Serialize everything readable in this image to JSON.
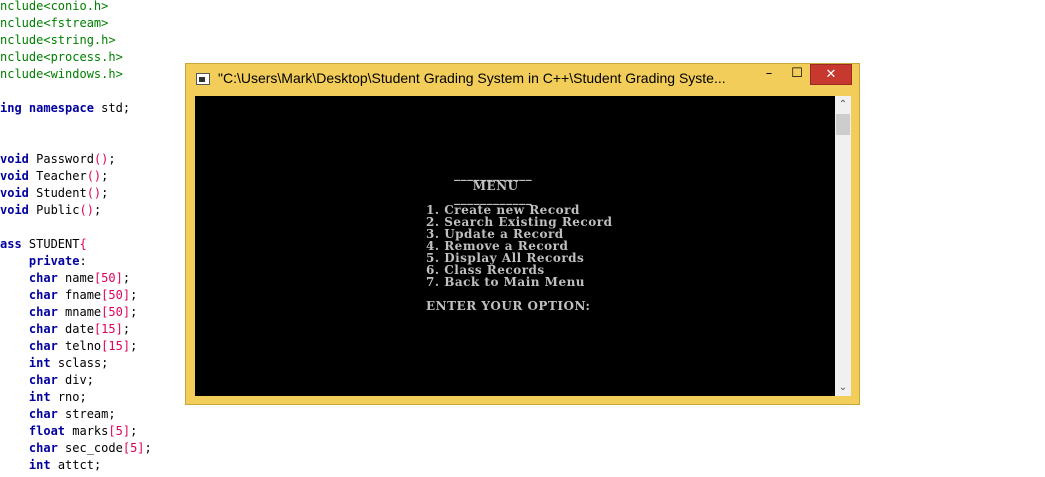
{
  "editor": {
    "lines": [
      {
        "parts": [
          {
            "t": "nclude<conio.h>",
            "c": "kw-green"
          }
        ]
      },
      {
        "parts": [
          {
            "t": "nclude<fstream>",
            "c": "kw-green"
          }
        ]
      },
      {
        "parts": [
          {
            "t": "nclude<string.h>",
            "c": "kw-green"
          }
        ]
      },
      {
        "parts": [
          {
            "t": "nclude<process.h>",
            "c": "kw-green"
          }
        ]
      },
      {
        "parts": [
          {
            "t": "nclude<windows.h>",
            "c": "kw-green"
          }
        ]
      },
      {
        "parts": [
          {
            "t": "",
            "c": "kw-plain"
          }
        ]
      },
      {
        "parts": [
          {
            "t": "ing namespace",
            "c": "kw-blue"
          },
          {
            "t": " std;",
            "c": "kw-plain"
          }
        ]
      },
      {
        "parts": [
          {
            "t": "",
            "c": "kw-plain"
          }
        ]
      },
      {
        "parts": [
          {
            "t": "",
            "c": "kw-plain"
          }
        ]
      },
      {
        "parts": [
          {
            "t": "void",
            "c": "kw-blue"
          },
          {
            "t": " Password",
            "c": "kw-plain"
          },
          {
            "t": "()",
            "c": "kw-red"
          },
          {
            "t": ";",
            "c": "kw-plain"
          }
        ]
      },
      {
        "parts": [
          {
            "t": "void",
            "c": "kw-blue"
          },
          {
            "t": " Teacher",
            "c": "kw-plain"
          },
          {
            "t": "()",
            "c": "kw-red"
          },
          {
            "t": ";",
            "c": "kw-plain"
          }
        ]
      },
      {
        "parts": [
          {
            "t": "void",
            "c": "kw-blue"
          },
          {
            "t": " Student",
            "c": "kw-plain"
          },
          {
            "t": "()",
            "c": "kw-red"
          },
          {
            "t": ";",
            "c": "kw-plain"
          }
        ]
      },
      {
        "parts": [
          {
            "t": "void",
            "c": "kw-blue"
          },
          {
            "t": " Public",
            "c": "kw-plain"
          },
          {
            "t": "()",
            "c": "kw-red"
          },
          {
            "t": ";",
            "c": "kw-plain"
          }
        ]
      },
      {
        "parts": [
          {
            "t": "",
            "c": "kw-plain"
          }
        ]
      },
      {
        "parts": [
          {
            "t": "ass",
            "c": "kw-blue"
          },
          {
            "t": " STUDENT",
            "c": "kw-plain"
          },
          {
            "t": "{",
            "c": "kw-red"
          }
        ]
      },
      {
        "parts": [
          {
            "t": "    ",
            "c": "kw-plain"
          },
          {
            "t": "private",
            "c": "kw-blue"
          },
          {
            "t": ":",
            "c": "kw-plain"
          }
        ]
      },
      {
        "parts": [
          {
            "t": "    ",
            "c": "kw-plain"
          },
          {
            "t": "char",
            "c": "kw-blue"
          },
          {
            "t": " name",
            "c": "kw-plain"
          },
          {
            "t": "[50]",
            "c": "kw-red"
          },
          {
            "t": ";",
            "c": "kw-plain"
          }
        ]
      },
      {
        "parts": [
          {
            "t": "    ",
            "c": "kw-plain"
          },
          {
            "t": "char",
            "c": "kw-blue"
          },
          {
            "t": " fname",
            "c": "kw-plain"
          },
          {
            "t": "[50]",
            "c": "kw-red"
          },
          {
            "t": ";",
            "c": "kw-plain"
          }
        ]
      },
      {
        "parts": [
          {
            "t": "    ",
            "c": "kw-plain"
          },
          {
            "t": "char",
            "c": "kw-blue"
          },
          {
            "t": " mname",
            "c": "kw-plain"
          },
          {
            "t": "[50]",
            "c": "kw-red"
          },
          {
            "t": ";",
            "c": "kw-plain"
          }
        ]
      },
      {
        "parts": [
          {
            "t": "    ",
            "c": "kw-plain"
          },
          {
            "t": "char",
            "c": "kw-blue"
          },
          {
            "t": " date",
            "c": "kw-plain"
          },
          {
            "t": "[15]",
            "c": "kw-red"
          },
          {
            "t": ";",
            "c": "kw-plain"
          }
        ]
      },
      {
        "parts": [
          {
            "t": "    ",
            "c": "kw-plain"
          },
          {
            "t": "char",
            "c": "kw-blue"
          },
          {
            "t": " telno",
            "c": "kw-plain"
          },
          {
            "t": "[15]",
            "c": "kw-red"
          },
          {
            "t": ";",
            "c": "kw-plain"
          }
        ]
      },
      {
        "parts": [
          {
            "t": "    ",
            "c": "kw-plain"
          },
          {
            "t": "int",
            "c": "kw-blue"
          },
          {
            "t": " sclass;",
            "c": "kw-plain"
          }
        ]
      },
      {
        "parts": [
          {
            "t": "    ",
            "c": "kw-plain"
          },
          {
            "t": "char",
            "c": "kw-blue"
          },
          {
            "t": " div;",
            "c": "kw-plain"
          }
        ]
      },
      {
        "parts": [
          {
            "t": "    ",
            "c": "kw-plain"
          },
          {
            "t": "int",
            "c": "kw-blue"
          },
          {
            "t": " rno;",
            "c": "kw-plain"
          }
        ]
      },
      {
        "parts": [
          {
            "t": "    ",
            "c": "kw-plain"
          },
          {
            "t": "char",
            "c": "kw-blue"
          },
          {
            "t": " stream;",
            "c": "kw-plain"
          }
        ]
      },
      {
        "parts": [
          {
            "t": "    ",
            "c": "kw-plain"
          },
          {
            "t": "float",
            "c": "kw-blue"
          },
          {
            "t": " marks",
            "c": "kw-plain"
          },
          {
            "t": "[5]",
            "c": "kw-red"
          },
          {
            "t": ";",
            "c": "kw-plain"
          }
        ]
      },
      {
        "parts": [
          {
            "t": "    ",
            "c": "kw-plain"
          },
          {
            "t": "char",
            "c": "kw-blue"
          },
          {
            "t": " sec_code",
            "c": "kw-plain"
          },
          {
            "t": "[5]",
            "c": "kw-red"
          },
          {
            "t": ";",
            "c": "kw-plain"
          }
        ]
      },
      {
        "parts": [
          {
            "t": "    ",
            "c": "kw-plain"
          },
          {
            "t": "int",
            "c": "kw-blue"
          },
          {
            "t": " attct;",
            "c": "kw-plain"
          }
        ]
      }
    ]
  },
  "window": {
    "title": "\"C:\\Users\\Mark\\Desktop\\Student Grading System in C++\\Student Grading Syste...",
    "minimize_label": "–",
    "maximize_label": "☐",
    "close_label": "✕",
    "scroll_up_label": "⌃",
    "scroll_down_label": "⌄",
    "icon": "console-icon"
  },
  "console": {
    "text": "      ____________\n          MENU\n      ____________\n1. Create new Record\n2. Search Existing Record\n3. Update a Record\n4. Remove a Record\n5. Display All Records\n6. Class Records\n7. Back to Main Menu\n\nENTER YOUR OPTION:"
  }
}
